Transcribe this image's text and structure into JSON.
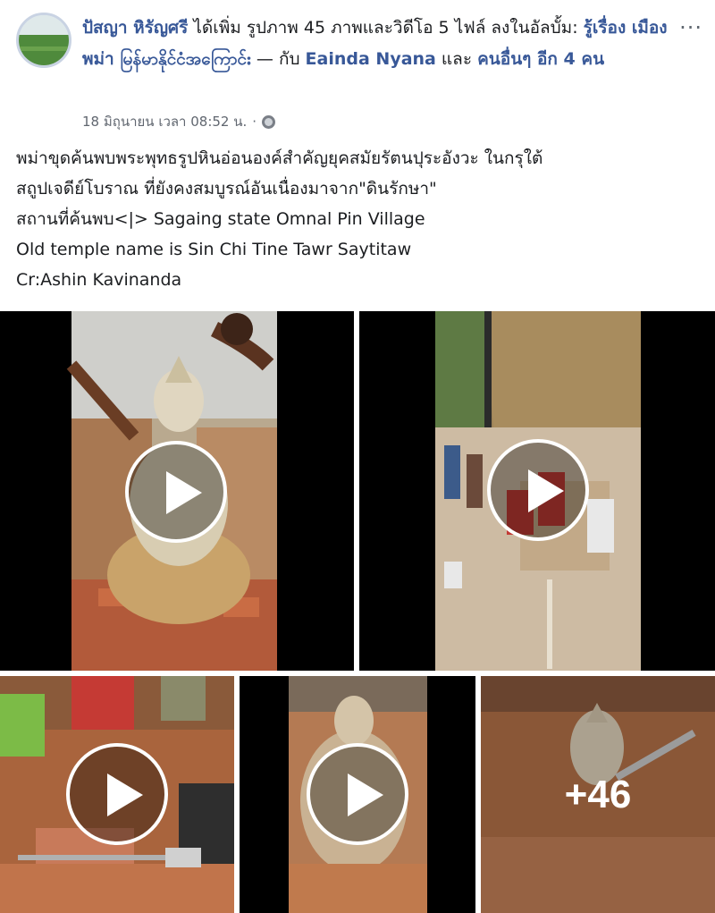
{
  "post": {
    "author": "ปัสญา หิรัญศรี",
    "action_text": " ได้เพิ่ม รูปภาพ 45 ภาพและวิดีโอ 5 ไฟล์ ลงในอัลบั้ม: ",
    "album_name": "รู้เรื่อง เมืองพม่า မြန်မာနိုင်ငံအကြောင်း",
    "with_text": " — กับ ",
    "tagged_person": "Eainda Nyana",
    "others_text": " และ ",
    "others_link": "คนอื่นๆ อีก 4 คน",
    "timestamp": "18 มิถุนายน เวลา 08:52 น.",
    "separator": "·",
    "more_options": "...",
    "body_lines": [
      "พม่าขุดค้นพบพระพุทธรูปหินอ่อนองค์สำคัญยุคสมัยรัตนปุระอังวะ ในกรุใต้",
      "สถูปเจดีย์โบราณ ที่ยังคงสมบูรณ์อันเนื่องมาจาก\"ดินรักษา\"",
      "สถานที่ค้นพบ<|> Sagaing state Omnal Pin Village",
      "Old temple name is Sin Chi Tine Tawr Saytitaw",
      "Cr:Ashin Kavinanda"
    ]
  },
  "media": {
    "more_count": "+46",
    "items": [
      {
        "kind": "video",
        "icon": "play-icon"
      },
      {
        "kind": "video",
        "icon": "play-icon"
      },
      {
        "kind": "video",
        "icon": "play-icon"
      },
      {
        "kind": "video",
        "icon": "play-icon"
      },
      {
        "kind": "photo",
        "icon": "more-photos-overlay"
      }
    ]
  },
  "colors": {
    "link": "#385898",
    "text": "#1c1e21",
    "meta": "#616770"
  }
}
